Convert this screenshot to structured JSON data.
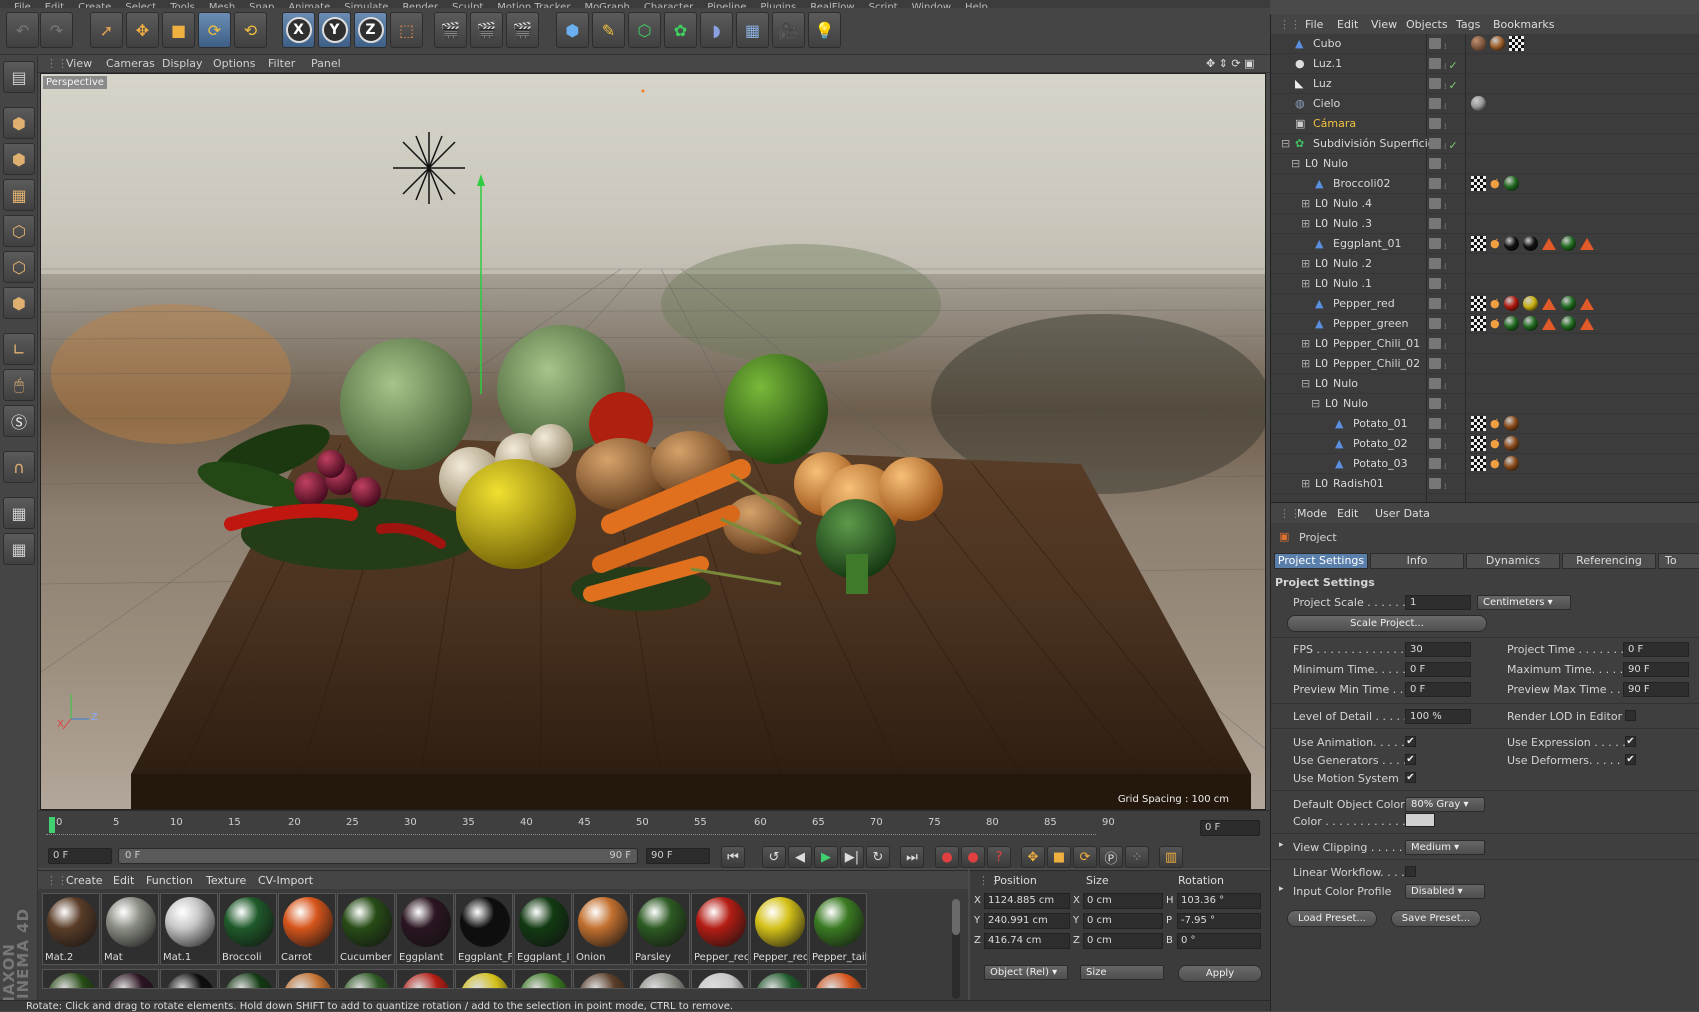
{
  "menubar": [
    "File",
    "Edit",
    "Create",
    "Select",
    "Tools",
    "Mesh",
    "Snap",
    "Animate",
    "Simulate",
    "Render",
    "Sculpt",
    "Motion Tracker",
    "MoGraph",
    "Character",
    "Pipeline",
    "Plugins",
    "RealFlow",
    "Script",
    "Window",
    "Help"
  ],
  "toolbar": {
    "x_label": "X",
    "y_label": "Y",
    "z_label": "Z"
  },
  "viewport": {
    "menu": [
      "View",
      "Cameras",
      "Display",
      "Options",
      "Filter",
      "Panel"
    ],
    "camera_label": "Perspective",
    "grid_spacing": "Grid Spacing : 100 cm",
    "axis_x": "X",
    "axis_z": "Z"
  },
  "timeline": {
    "ticks": [
      "0",
      "5",
      "10",
      "15",
      "20",
      "25",
      "30",
      "35",
      "40",
      "45",
      "50",
      "55",
      "60",
      "65",
      "70",
      "75",
      "80",
      "85",
      "90"
    ],
    "current_frame": "0 F",
    "start_field": "0 F",
    "range_start": "0 F",
    "range_end": "90 F",
    "end_field": "90 F"
  },
  "materials": {
    "menu": [
      "Create",
      "Edit",
      "Function",
      "Texture",
      "CV-Import"
    ],
    "items": [
      {
        "name": "Mat.2",
        "color": "#5a3d28"
      },
      {
        "name": "Mat",
        "color": "#8c8f86"
      },
      {
        "name": "Mat.1",
        "color": "#c8c8c8"
      },
      {
        "name": "Broccoli",
        "color": "#1f5a2a"
      },
      {
        "name": "Carrot",
        "color": "#d6551b"
      },
      {
        "name": "Cucumber",
        "color": "#274c16"
      },
      {
        "name": "Eggplant",
        "color": "#2b1522"
      },
      {
        "name": "Eggplant_F",
        "color": "#0d0d0d"
      },
      {
        "name": "Eggplant_I",
        "color": "#123a12"
      },
      {
        "name": "Onion",
        "color": "#c2702f"
      },
      {
        "name": "Parsley",
        "color": "#2d5a23"
      },
      {
        "name": "Pepper_rec",
        "color": "#b41d14"
      },
      {
        "name": "Pepper_rec",
        "color": "#d4c119"
      },
      {
        "name": "Pepper_tail",
        "color": "#3a7a22"
      }
    ]
  },
  "coords": {
    "headers": [
      "Position",
      "Size",
      "Rotation"
    ],
    "rows": [
      {
        "axis": "X",
        "pos": "1124.885 cm",
        "size_axis": "X",
        "size": "0 cm",
        "rot_axis": "H",
        "rot": "103.36 °"
      },
      {
        "axis": "Y",
        "pos": "240.991 cm",
        "size_axis": "Y",
        "size": "0 cm",
        "rot_axis": "P",
        "rot": "-7.95 °"
      },
      {
        "axis": "Z",
        "pos": "416.74 cm",
        "size_axis": "Z",
        "size": "0 cm",
        "rot_axis": "B",
        "rot": "0 °"
      }
    ],
    "mode": "Object (Rel)",
    "size_mode": "Size",
    "apply": "Apply"
  },
  "status": "Rotate: Click and drag to rotate elements. Hold down SHIFT to add to quantize rotation / add to the selection in point mode, CTRL to remove.",
  "brand": "MAXON CINEMA 4D",
  "objects": {
    "menu": [
      "File",
      "Edit",
      "View",
      "Objects",
      "Tags",
      "Bookmarks"
    ],
    "items": [
      {
        "name": "Cubo",
        "indent": 0,
        "type": "poly",
        "tags": [
          "mat",
          "sphere-warm",
          "chk"
        ]
      },
      {
        "name": "Luz.1",
        "indent": 0,
        "type": "light",
        "tags": []
      },
      {
        "name": "Luz",
        "indent": 0,
        "type": "light2",
        "tags": []
      },
      {
        "name": "Cielo",
        "indent": 0,
        "type": "sky",
        "tags": [
          "sky"
        ]
      },
      {
        "name": "Cámara",
        "indent": 0,
        "type": "cam",
        "tags": []
      },
      {
        "name": "Subdivisión Superficie",
        "indent": 0,
        "type": "sds",
        "tags": []
      },
      {
        "name": "Nulo",
        "indent": 1,
        "type": "null",
        "tags": []
      },
      {
        "name": "Broccoli02",
        "indent": 2,
        "type": "poly",
        "tags": [
          "chk",
          "phong",
          "ball-green"
        ]
      },
      {
        "name": "Nulo .4",
        "indent": 2,
        "type": "null",
        "tags": []
      },
      {
        "name": "Nulo .3",
        "indent": 2,
        "type": "null",
        "tags": []
      },
      {
        "name": "Eggplant_01",
        "indent": 2,
        "type": "poly",
        "tags": [
          "chk",
          "phong",
          "ball-black",
          "ball-black",
          "tri",
          "ball-green",
          "tri"
        ]
      },
      {
        "name": "Nulo .2",
        "indent": 2,
        "type": "null",
        "tags": []
      },
      {
        "name": "Nulo .1",
        "indent": 2,
        "type": "null",
        "tags": []
      },
      {
        "name": "Pepper_red",
        "indent": 2,
        "type": "poly",
        "tags": [
          "chk",
          "phong",
          "ball-red",
          "ball-yellow",
          "tri",
          "ball-green",
          "tri"
        ]
      },
      {
        "name": "Pepper_green",
        "indent": 2,
        "type": "poly",
        "tags": [
          "chk",
          "phong",
          "ball-green",
          "ball-green",
          "tri",
          "ball-green",
          "tri"
        ]
      },
      {
        "name": "Pepper_Chili_01",
        "indent": 2,
        "type": "null",
        "tags": []
      },
      {
        "name": "Pepper_Chili_02",
        "indent": 2,
        "type": "null",
        "tags": []
      },
      {
        "name": "Nulo",
        "indent": 2,
        "type": "null",
        "tags": []
      },
      {
        "name": "Nulo",
        "indent": 3,
        "type": "null",
        "tags": []
      },
      {
        "name": "Potato_01",
        "indent": 4,
        "type": "poly",
        "tags": [
          "chk",
          "phong",
          "ball-brown"
        ]
      },
      {
        "name": "Potato_02",
        "indent": 4,
        "type": "poly",
        "tags": [
          "chk",
          "phong",
          "ball-brown"
        ]
      },
      {
        "name": "Potato_03",
        "indent": 4,
        "type": "poly",
        "tags": [
          "chk",
          "phong",
          "ball-brown"
        ]
      },
      {
        "name": "Radish01",
        "indent": 2,
        "type": "null",
        "tags": []
      }
    ]
  },
  "attributes": {
    "menu": [
      "Mode",
      "Edit",
      "User Data"
    ],
    "title": "Project",
    "tabs": [
      "Project Settings",
      "Info",
      "Dynamics",
      "Referencing",
      "To"
    ],
    "section": "Project Settings",
    "project_scale_label": "Project Scale . . . . . .",
    "project_scale_value": "1",
    "project_scale_unit": "Centimeters",
    "scale_project_button": "Scale Project...",
    "fps_label": "FPS . . . . . . . . . . . . . . .",
    "fps_value": "30",
    "project_time_label": "Project Time . . . . . . . .",
    "project_time_value": "0 F",
    "min_time_label": "Minimum Time. . . . . . .",
    "min_time_value": "0 F",
    "max_time_label": "Maximum Time. . . . . .",
    "max_time_value": "90 F",
    "prev_min_label": "Preview Min Time . . .",
    "prev_min_value": "0 F",
    "prev_max_label": "Preview Max Time . . .",
    "prev_max_value": "90 F",
    "lod_label": "Level of Detail . . . . . .",
    "lod_value": "100 %",
    "render_lod_label": "Render LOD in Editor",
    "use_anim_label": "Use Animation. . . . . .",
    "use_expr_label": "Use Expression . . . . . .",
    "use_gen_label": "Use Generators . . . . .",
    "use_def_label": "Use Deformers. . . . . .",
    "use_motion_label": "Use Motion System",
    "default_color_label": "Default Object Color",
    "default_color_value": "80% Gray",
    "color_label": "Color . . . . . . . . . . . .",
    "view_clip_label": "View Clipping . . . . . .",
    "view_clip_value": "Medium",
    "linear_wf_label": "Linear Workflow. . . . .",
    "input_profile_label": "Input Color Profile",
    "input_profile_value": "Disabled",
    "load_preset": "Load Preset...",
    "save_preset": "Save Preset...",
    "check": "✔"
  }
}
